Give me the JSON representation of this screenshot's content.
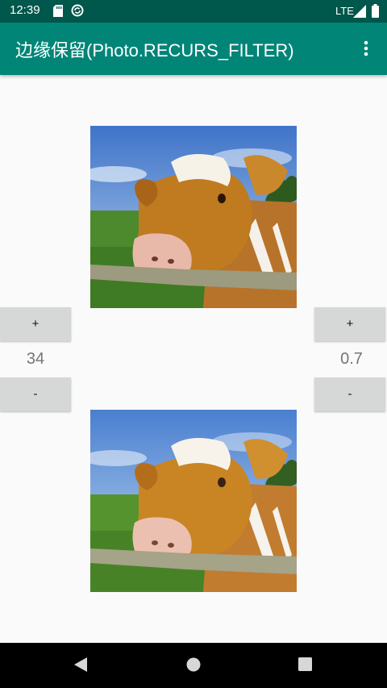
{
  "status_bar": {
    "time": "12:39",
    "network": "LTE",
    "icons": [
      "sd-card-icon",
      "sync-icon",
      "signal-icon",
      "battery-icon"
    ]
  },
  "app_bar": {
    "title": "边缘保留(Photo.RECURS_FILTER)",
    "menu_icon": "more-vert-icon",
    "background": "#008577",
    "status_background": "#00574b"
  },
  "left_control": {
    "increment_label": "+",
    "value": "34",
    "decrement_label": "-"
  },
  "right_control": {
    "increment_label": "+",
    "value": "0.7",
    "decrement_label": "-"
  },
  "images": {
    "original": "cow-photo",
    "filtered": "cow-photo-edge-preserving-filtered"
  },
  "nav_bar": {
    "icons": [
      "back-icon",
      "home-icon",
      "recents-icon"
    ]
  }
}
